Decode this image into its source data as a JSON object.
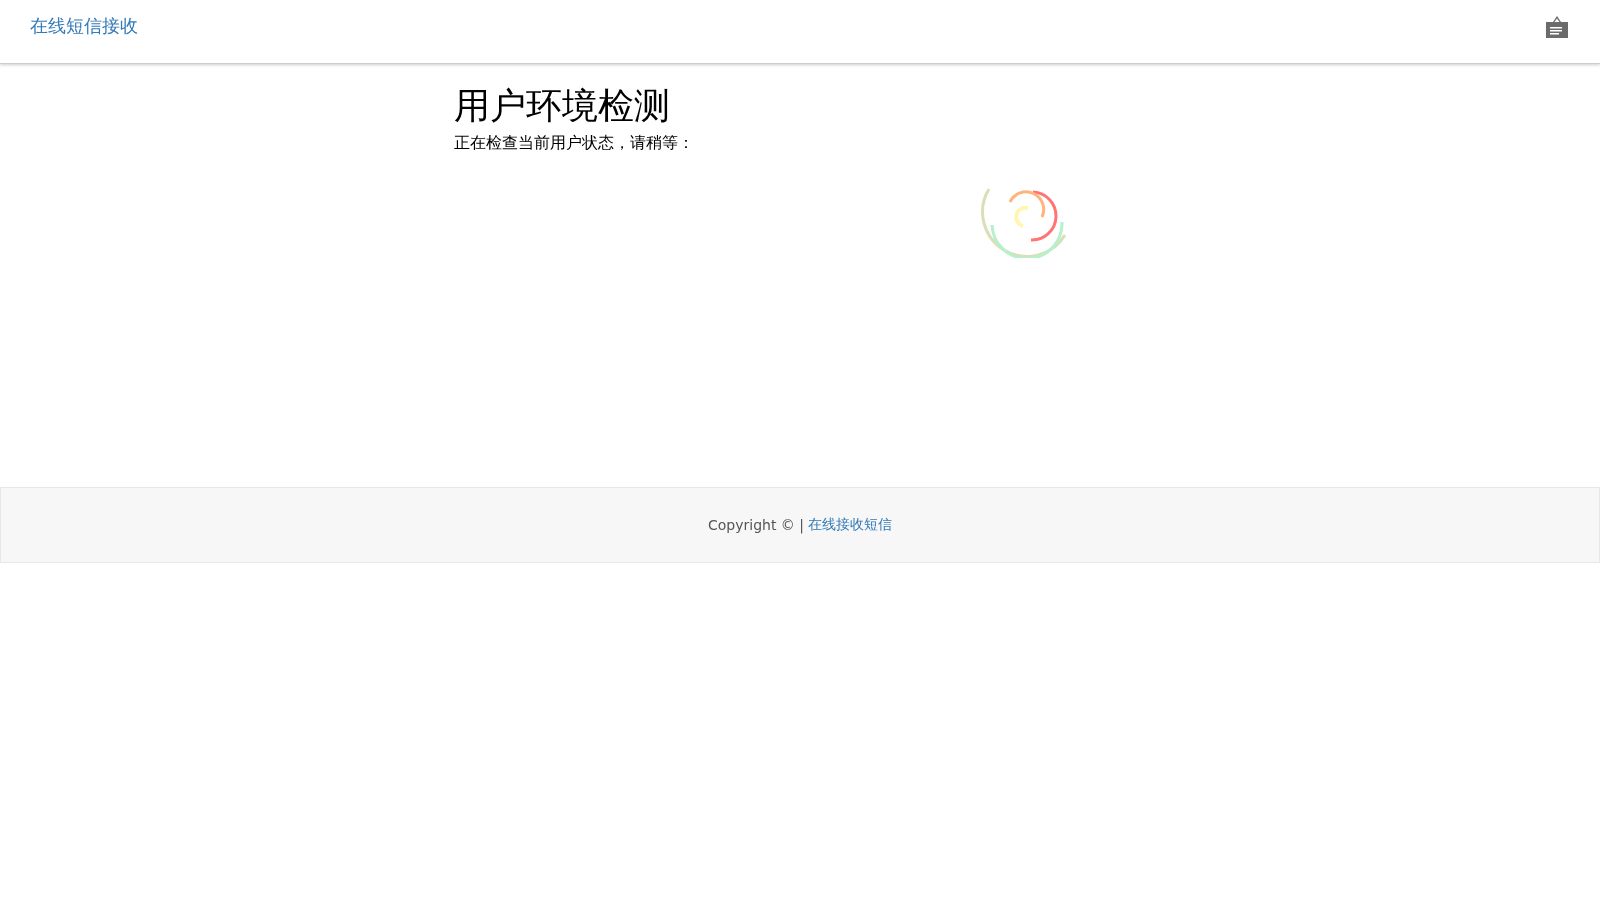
{
  "navbar": {
    "brand": "在线短信接收"
  },
  "main": {
    "title": "用户环境检测",
    "message": "正在检查当前用户状态，请稍等："
  },
  "footer": {
    "copyright": "Copyright © |",
    "link": "在线接收短信"
  }
}
